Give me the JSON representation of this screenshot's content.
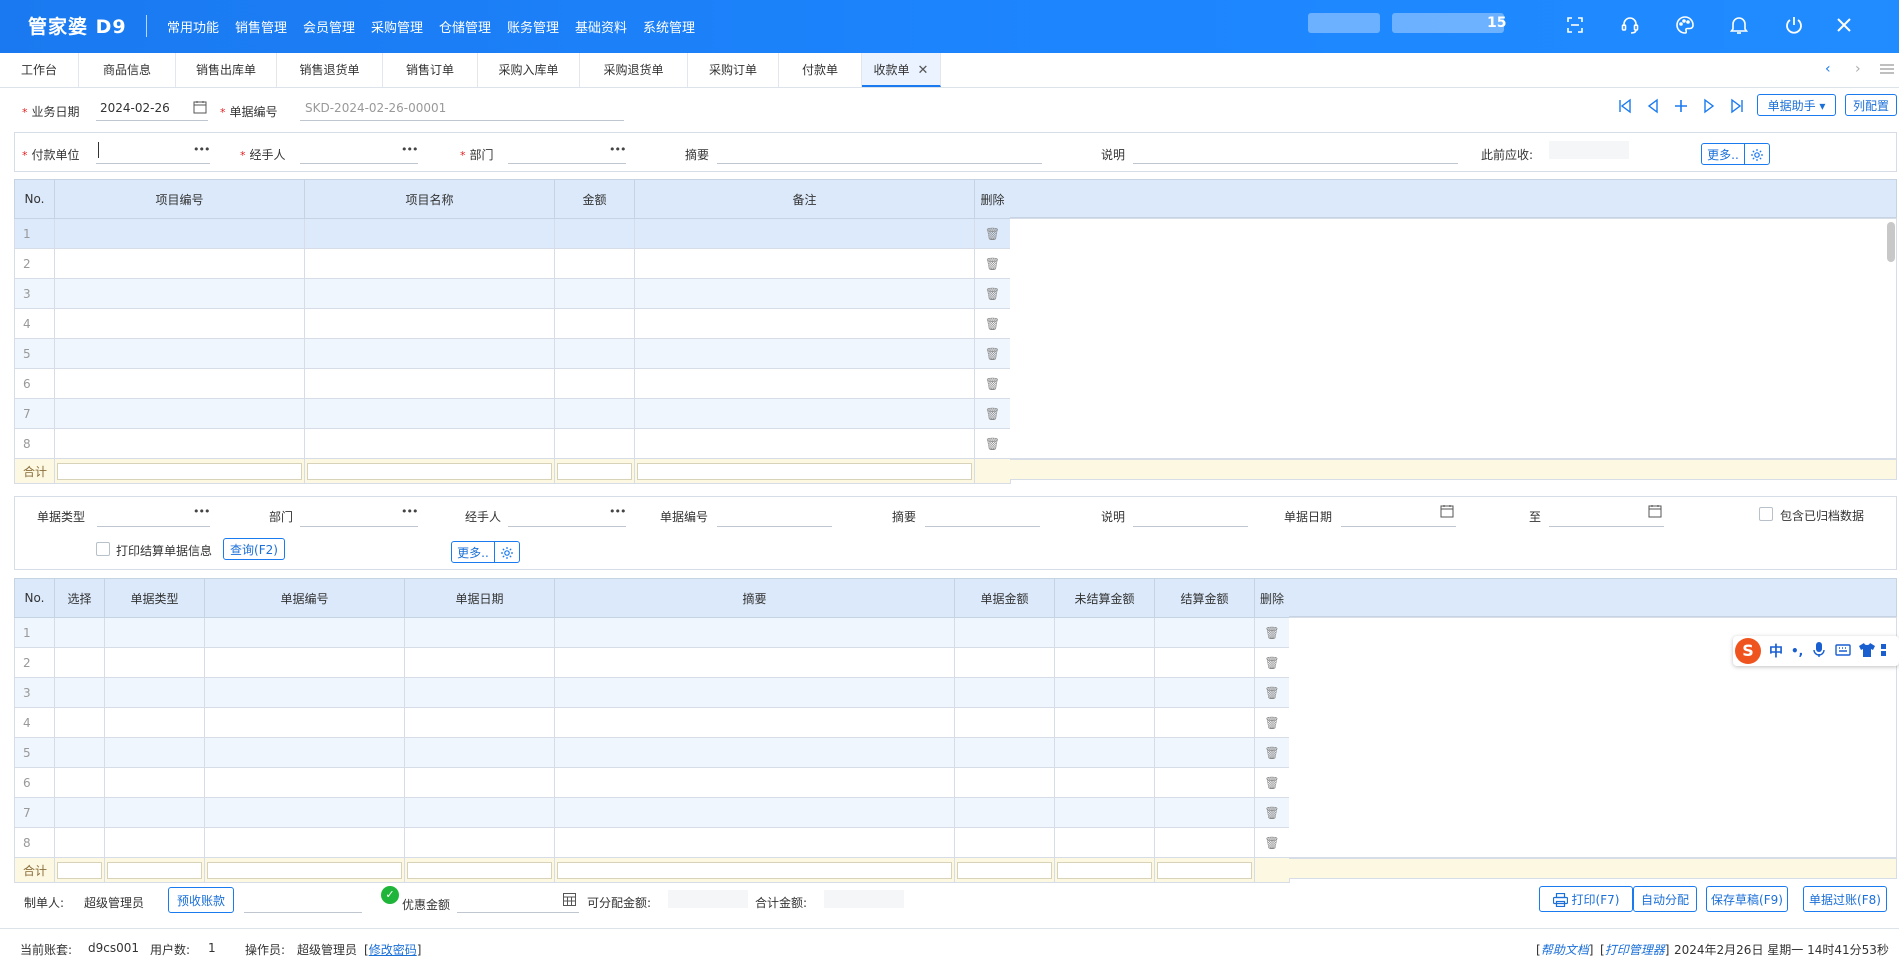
{
  "app": {
    "logo": "管家婆 D9",
    "menu": [
      "常用功能",
      "销售管理",
      "会员管理",
      "采购管理",
      "仓储管理",
      "账务管理",
      "基础资料",
      "系统管理"
    ],
    "user_suffix": "15",
    "icons": [
      "fullscreen-icon",
      "headset-icon",
      "palette-icon",
      "bell-icon",
      "power-icon",
      "close-icon"
    ]
  },
  "tabs": [
    "工作台",
    "商品信息",
    "销售出库单",
    "销售退货单",
    "销售订单",
    "采购入库单",
    "采购退货单",
    "采购订单",
    "付款单",
    "收款单"
  ],
  "active_tab": "收款单",
  "header": {
    "biz_date_label": "业务日期",
    "biz_date": "2024-02-26",
    "doc_no_label": "单据编号",
    "doc_no": "SKD-2024-02-26-00001",
    "assistant_btn": "单据助手 ▾",
    "col_config_btn": "列配置",
    "payer_label": "付款单位",
    "handler_label": "经手人",
    "dept_label": "部门",
    "summary_label": "摘要",
    "note_label": "说明",
    "prev_receivable_label": "此前应收:",
    "more_btn": "更多.."
  },
  "grid1": {
    "columns": [
      "No.",
      "项目编号",
      "项目名称",
      "金额",
      "备注",
      "删除"
    ],
    "rows": [
      "1",
      "2",
      "3",
      "4",
      "5",
      "6",
      "7",
      "8"
    ],
    "sum_label": "合计"
  },
  "filter": {
    "doc_type_label": "单据类型",
    "dept_label": "部门",
    "handler_label": "经手人",
    "doc_no_label": "单据编号",
    "summary_label": "摘要",
    "note_label": "说明",
    "doc_date_label": "单据日期",
    "to_label": "至",
    "include_archived_label": "包含已归档数据",
    "print_settle_label": "打印结算单据信息",
    "query_btn": "查询(F2)",
    "more_btn": "更多.."
  },
  "grid2": {
    "columns": [
      "No.",
      "选择",
      "单据类型",
      "单据编号",
      "单据日期",
      "摘要",
      "单据金额",
      "未结算金额",
      "结算金额",
      "删除"
    ],
    "rows": [
      "1",
      "2",
      "3",
      "4",
      "5",
      "6",
      "7",
      "8"
    ],
    "sum_label": "合计"
  },
  "footer": {
    "maker_label": "制单人:",
    "maker": "超级管理员",
    "prepaid_btn": "预收账款",
    "discount_label": "优惠金额",
    "allocatable_label": "可分配金额:",
    "total_label": "合计金额:",
    "print_btn": "打印(F7)",
    "auto_alloc_btn": "自动分配",
    "save_draft_btn": "保存草稿(F9)",
    "post_btn": "单据过账(F8)"
  },
  "status": {
    "account_label": "当前账套:",
    "account": "d9cs001",
    "users_label": "用户数:",
    "users": "1",
    "operator_label": "操作员:",
    "operator": "超级管理员",
    "change_pwd": "修改密码",
    "help_doc": "帮助文档",
    "print_mgr": "打印管理器",
    "datetime": "2024年2月26日 星期一  14时41分53秒"
  },
  "ime": {
    "mode": "中",
    "punct": "•,"
  }
}
